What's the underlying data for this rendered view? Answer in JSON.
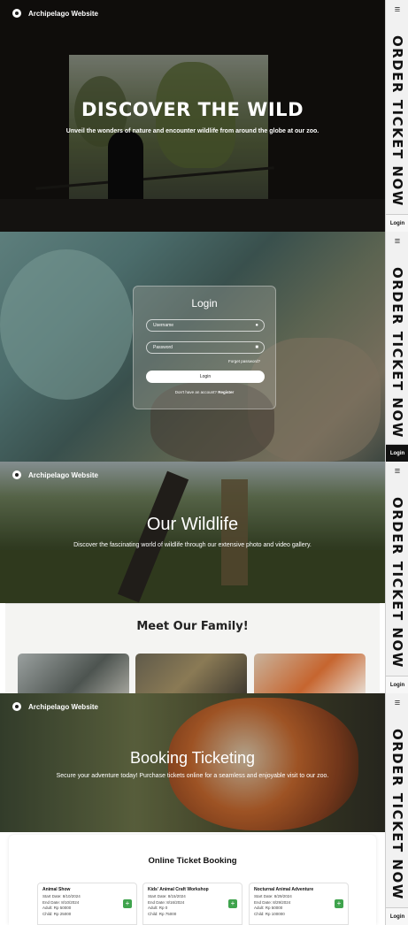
{
  "brand": "Archipelago Website",
  "side_cta": "ORDER TICKET NOW",
  "side_menu": "≡",
  "side_login": "Login",
  "home": {
    "title": "DISCOVER THE WILD",
    "subtitle": "Unveil the wonders of nature and encounter wildlife from around the globe at our zoo."
  },
  "login": {
    "title": "Login",
    "username_placeholder": "Username",
    "password_placeholder": "Password",
    "user_icon": "person-icon",
    "lock_icon": "lock-icon",
    "forgot": "Forget password?",
    "button": "Login",
    "register_prompt": "Don't have an account?",
    "register_link": "Register"
  },
  "wildlife": {
    "title": "Our Wildlife",
    "subtitle": "Discover the fascinating world of wildlife through our extensive photo and video gallery.",
    "section_title": "Meet Our Family!"
  },
  "booking": {
    "title": "Booking Ticketing",
    "subtitle": "Secure your adventure today! Purchase tickets online for a seamless and enjoyable visit to our zoo.",
    "section_title": "Online Ticket Booking",
    "add_symbol": "+",
    "tickets": [
      {
        "name": "Animal Show",
        "start": "Start Date: 8/10/2024",
        "end": "End Date: 8/10/2024",
        "adult": "Adult: Rp 50000",
        "child": "Child: Rp 25000"
      },
      {
        "name": "Kids' Animal Craft Workshop",
        "start": "Start Date: 8/15/2024",
        "end": "End Date: 8/16/2024",
        "adult": "Adult: Rp 0",
        "child": "Child: Rp 75000"
      },
      {
        "name": "Nocturnal Animal Adventure",
        "start": "Start Date: 8/29/2024",
        "end": "End Date: 8/29/2024",
        "adult": "Adult: Rp 50000",
        "child": "Child: Rp 100000"
      }
    ]
  },
  "colors": {
    "add_button": "#3fa34d",
    "sidebar": "#f1f1f1"
  }
}
